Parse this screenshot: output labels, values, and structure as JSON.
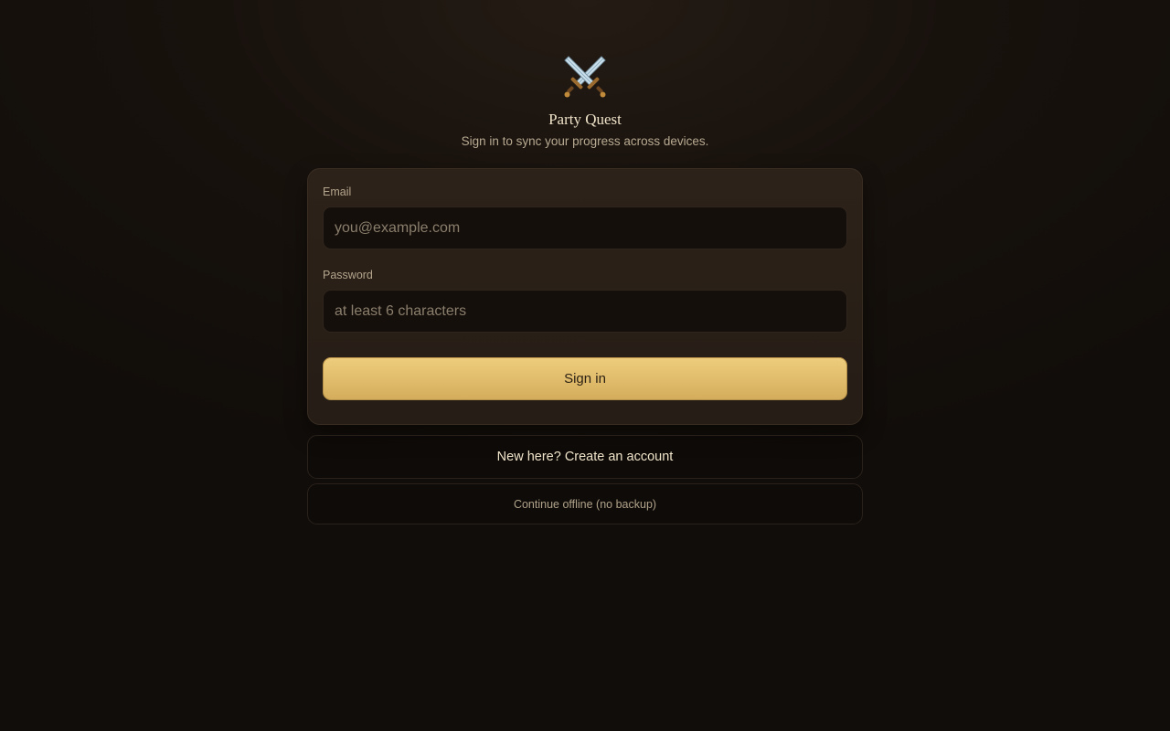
{
  "app": {
    "logo_icon": "crossed-swords-icon",
    "title": "Party Quest",
    "subtitle": "Sign in to sync your progress across devices."
  },
  "form": {
    "email_label": "Email",
    "email_placeholder": "you@example.com",
    "email_value": "",
    "password_label": "Password",
    "password_placeholder": "at least 6 characters",
    "password_value": "",
    "signin_label": "Sign in"
  },
  "secondary": {
    "create_account_label": "New here? Create an account",
    "offline_label": "Continue offline (no backup)"
  },
  "colors": {
    "accent": "#e2bf6c",
    "background": "#110d0a",
    "card": "#2a2018"
  }
}
